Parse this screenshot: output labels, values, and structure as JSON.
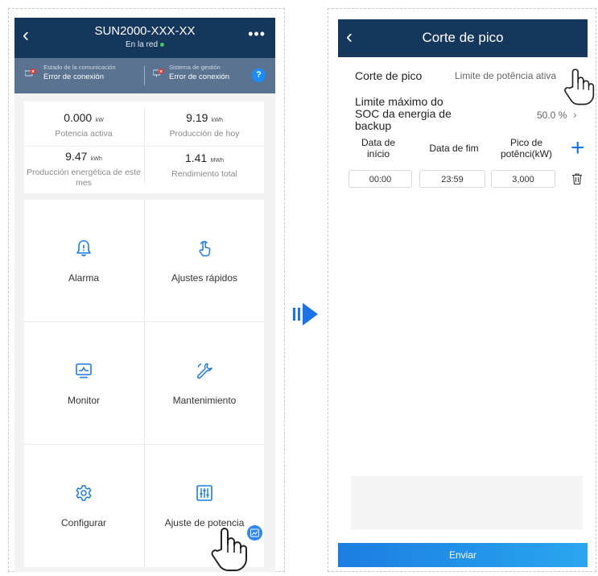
{
  "left_screen": {
    "header": {
      "title": "SUN2000-XXX-XX",
      "subtitle": "En la red",
      "back_icon": "chevron-left-icon",
      "more_icon": "more-dots-icon"
    },
    "status_bar": {
      "comm_label": "Estado de la comunicación",
      "comm_value": "Error de conexión",
      "mgmt_label": "Sistema de gestión",
      "mgmt_value": "Error de conexión",
      "help_label": "?"
    },
    "kpis": [
      {
        "value": "0.000",
        "unit": "kW",
        "label": "Potencia activa"
      },
      {
        "value": "9.19",
        "unit": "kWh",
        "label": "Producción de hoy"
      },
      {
        "value": "9.47",
        "unit": "kWh",
        "label": "Producción energética de este mes"
      },
      {
        "value": "1.41",
        "unit": "MWh",
        "label": "Rendimiento total"
      }
    ],
    "menu": [
      {
        "label": "Alarma",
        "icon": "bell-icon"
      },
      {
        "label": "Ajustes rápidos",
        "icon": "touch-icon"
      },
      {
        "label": "Monitor",
        "icon": "monitor-icon"
      },
      {
        "label": "Mantenimiento",
        "icon": "wrench-icon"
      },
      {
        "label": "Configurar",
        "icon": "gear-icon"
      },
      {
        "label": "Ajuste de potencia",
        "icon": "sliders-icon"
      }
    ]
  },
  "right_screen": {
    "header": {
      "title": "Corte de pico"
    },
    "mode_row": {
      "label": "Corte de pico",
      "value": "Limite de potência ativa"
    },
    "soc_row": {
      "label_line1": "Limite máximo do",
      "label_line2": "SOC da energia de",
      "label_line3": "backup",
      "value": "50.0 %"
    },
    "table_headers": {
      "start_line1": "Data de",
      "start_line2": "início",
      "end": "Data de fim",
      "peak_line1": "Pico de",
      "peak_line2": "potênci(kW)"
    },
    "row": {
      "start": "00:00",
      "end": "23:59",
      "peak": "3,000"
    },
    "submit_label": "Enviar"
  },
  "colors": {
    "header": "#16375c",
    "status": "#5a7391",
    "accent": "#1a73e8",
    "error": "#e5342a"
  }
}
